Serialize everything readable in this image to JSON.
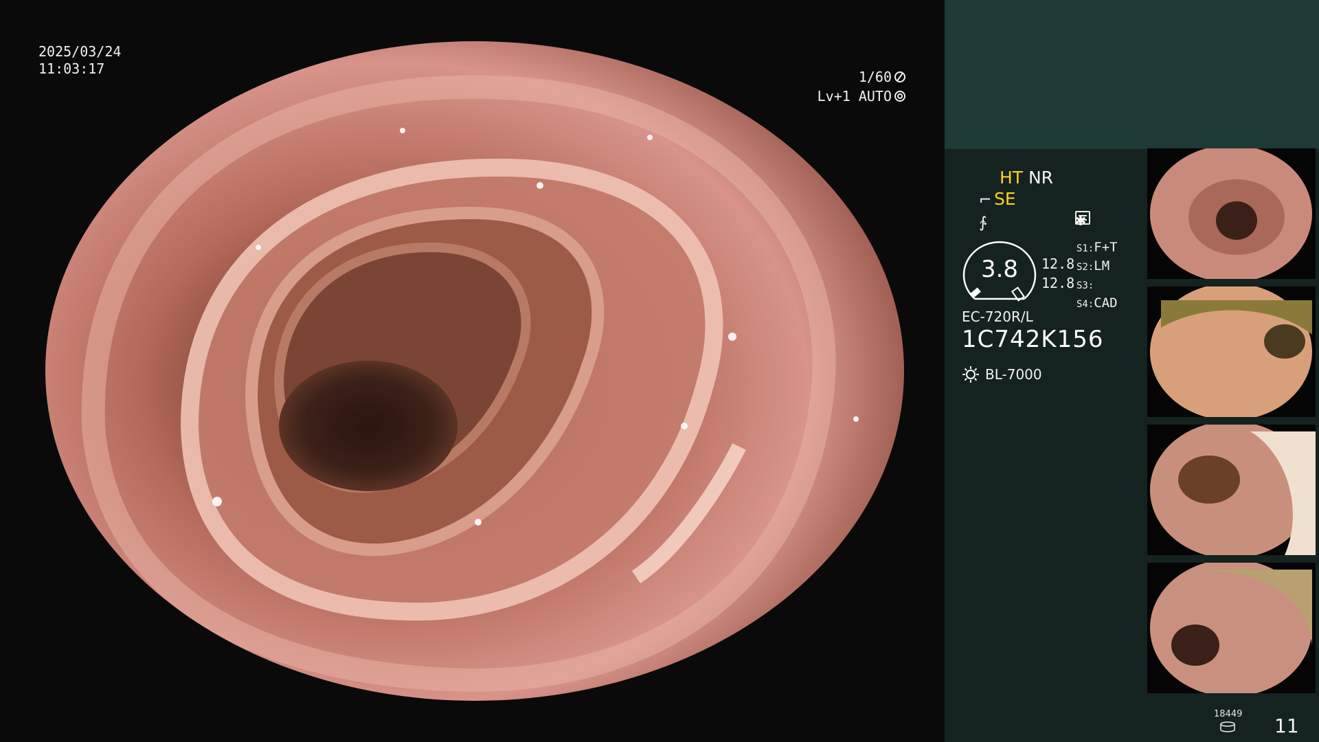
{
  "overlay": {
    "date": "2025/03/24",
    "time": "11:03:17",
    "shutter_speed": "1/60",
    "level": "Lv+1 AUTO"
  },
  "panel": {
    "mode_ht": "HT",
    "mode_nr": "NR",
    "mode_se": "SE",
    "gauge_value": "3.8",
    "gauge_num_1": "12.8",
    "gauge_num_2": "12.8",
    "settings": [
      {
        "key": "S1:",
        "value": "F+T"
      },
      {
        "key": "S2:",
        "value": "LM"
      },
      {
        "key": "S3:",
        "value": ""
      },
      {
        "key": "S4:",
        "value": "CAD"
      }
    ],
    "scope_model": "EC-720R/L",
    "scope_serial": "1C742K156",
    "light_source": "BL-7000",
    "record_count": "18449",
    "image_count": "11"
  },
  "icons": {
    "shutter": "shutter-icon",
    "iris": "iris-icon",
    "structure_enhance": "structure-enhance-icon",
    "color_enhance": "color-enhance-icon",
    "settings_box": "settings-box-icon",
    "asterisk": "asterisk-icon",
    "light": "sun-icon",
    "storage": "database-icon"
  },
  "colors": {
    "panel_bg": "#142220",
    "panel_top": "#1d3a36",
    "highlight": "#ffd21a"
  }
}
